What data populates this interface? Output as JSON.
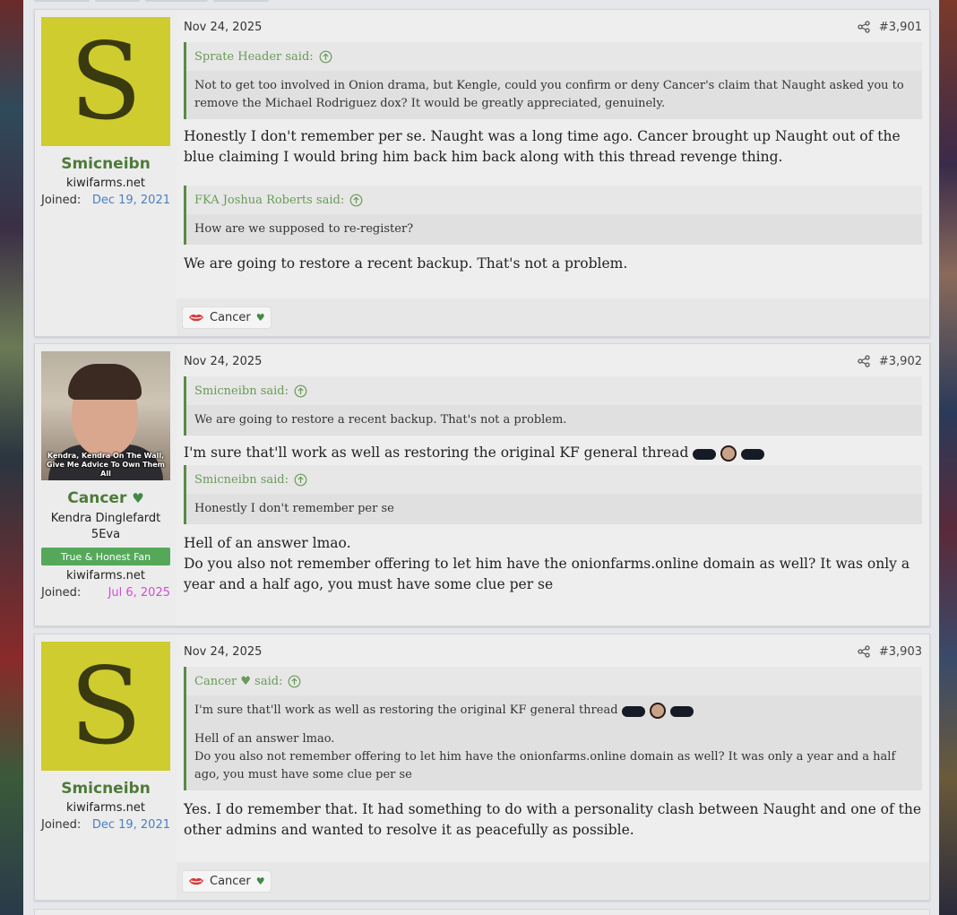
{
  "posts": [
    {
      "date": "Nov 24, 2025",
      "number": "#3,901",
      "user": {
        "avatar_letter": "S",
        "name": "Smicneibn",
        "site": "kiwifarms.net",
        "joined_label": "Joined:",
        "joined_date": "Dec 19, 2021"
      },
      "quotes": [
        {
          "author": "Sprate Header said:",
          "text": "Not to get too involved in Onion drama, but Kengle, could you confirm or deny Cancer's claim that Naught asked you to remove the Michael Rodriguez dox? It would be greatly appreciated, genuinely."
        },
        {
          "author": "FKA Joshua Roberts said:",
          "text": "How are we supposed to re-register?"
        }
      ],
      "body": [
        "Honestly I don't remember per se. Naught was a long time ago. Cancer brought up Naught out of the blue claiming I would bring him back him back along with this thread revenge thing.",
        "We are going to restore a recent backup. That's not a problem."
      ],
      "reaction": {
        "name": "Cancer",
        "heart": "♥",
        "icon": "lips-icon"
      }
    },
    {
      "date": "Nov 24, 2025",
      "number": "#3,902",
      "user": {
        "avatar_caption": "Kendra, Kendra On The Wall, Give Me Advice To Own Them All",
        "name": "Cancer",
        "name_heart": "♥",
        "title": "Kendra Dinglefardt 5Eva",
        "banner": "True & Honest Fan",
        "site": "kiwifarms.net",
        "joined_label": "Joined:",
        "joined_date": "Jul 6, 2025"
      },
      "quotes": [
        {
          "author": "Smicneibn said:",
          "text": "We are going to restore a recent backup. That's not a problem."
        },
        {
          "author": "Smicneibn said:",
          "text": "Honestly I don't remember per se"
        }
      ],
      "body": [
        "I'm sure that'll work as well as restoring the original KF general thread",
        "Hell of an answer lmao.",
        "Do you also not remember offering to let him have the onionfarms.online domain as well? It was only a year and a half ago, you must have some clue per se"
      ]
    },
    {
      "date": "Nov 24, 2025",
      "number": "#3,903",
      "user": {
        "avatar_letter": "S",
        "name": "Smicneibn",
        "site": "kiwifarms.net",
        "joined_label": "Joined:",
        "joined_date": "Dec 19, 2021"
      },
      "quotes": [
        {
          "author": "Cancer ♥ said:",
          "text": "I'm sure that'll work as well as restoring the original KF general thread",
          "text2": "Hell of an answer lmao.",
          "text3": "Do you also not remember offering to let him have the onionfarms.online domain as well? It was only a year and a half ago, you must have some clue per se"
        }
      ],
      "body": [
        "Yes. I do remember that. It had something to do with a personality clash between Naught and one of the other admins and wanted to resolve it as peacefully as possible."
      ],
      "reaction": {
        "name": "Cancer",
        "heart": "♥",
        "icon": "lips-icon"
      }
    }
  ],
  "colors": {
    "username": "#4e7a3a",
    "quote_border": "#5a8a48",
    "joined_blue": "#4a7fc0",
    "joined_pink": "#d24dd2",
    "banner": "#55a85a",
    "avatar_bg": "#cfcc2f"
  }
}
